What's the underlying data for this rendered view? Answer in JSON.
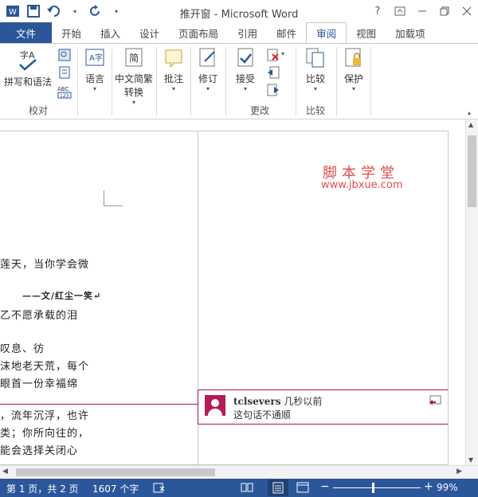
{
  "window": {
    "title": "推开窗 - Microsoft Word",
    "help": "?",
    "app_icon_letter": "W"
  },
  "tabs": [
    "文件",
    "开始",
    "插入",
    "设计",
    "页面布局",
    "引用",
    "邮件",
    "审阅",
    "视图",
    "加载项"
  ],
  "active_tab": "审阅",
  "ribbon": {
    "proofing": {
      "spelling": "拼写和语法",
      "group": "校对"
    },
    "language": "语言",
    "chinese_convert_line1": "中文简繁",
    "chinese_convert_line2": "转换",
    "comments": "批注",
    "tracking": "修订",
    "changes": {
      "accept": "接受",
      "group": "更改"
    },
    "compare": {
      "label": "比较",
      "group": "比较"
    },
    "protect": "保护"
  },
  "document": {
    "lines": [
      "莲天，当你学会微",
      "——文/红尘一笑↵",
      "乙不愿承载的泪",
      "  叹息、彷",
      "沫地老天荒，每个",
      "眼首一份幸福绵",
      "，流年沉浮，也许",
      "类；你所向往的，",
      "能会选择关闭心"
    ],
    "watermark_cn": "脚本学堂",
    "watermark_url": "www.jbxue.com"
  },
  "comment": {
    "author": "tclsevers",
    "time": "几秒以前",
    "text": "这句话不通顺"
  },
  "status": {
    "page": "第 1 页，共 2 页",
    "words": "1607 个字",
    "zoom": "99%"
  },
  "colors": {
    "brand": "#2b579a",
    "comment": "#a3155b",
    "watermark": "#e04d4d"
  }
}
